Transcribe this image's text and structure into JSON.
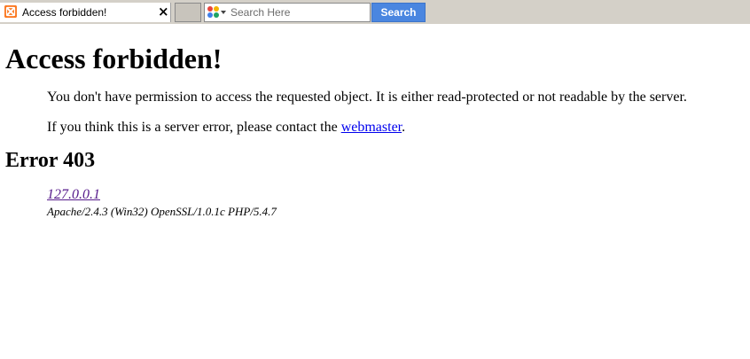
{
  "browser": {
    "tab": {
      "title": "Access forbidden!",
      "favicon": "xampp-logo-icon",
      "close": "×"
    },
    "search": {
      "placeholder": "Search Here",
      "value": "",
      "button_label": "Search",
      "engine_icon": "search-engine-icon"
    },
    "colors": {
      "toolbar_bg": "#d4d0c8",
      "search_button_bg": "#4a86e0",
      "favicon_orange": "#fb7a24"
    }
  },
  "page": {
    "heading": "Access forbidden!",
    "message": "You don't have permission to access the requested object. It is either read-protected or not readable by the server.",
    "contact_text": "If you think this is a server error, please contact the",
    "contact_link": "webmaster",
    "contact_suffix": ".",
    "error_heading": "Error 403",
    "host": "127.0.0.1",
    "server_signature": "Apache/2.4.3 (Win32) OpenSSL/1.0.1c PHP/5.4.7"
  }
}
